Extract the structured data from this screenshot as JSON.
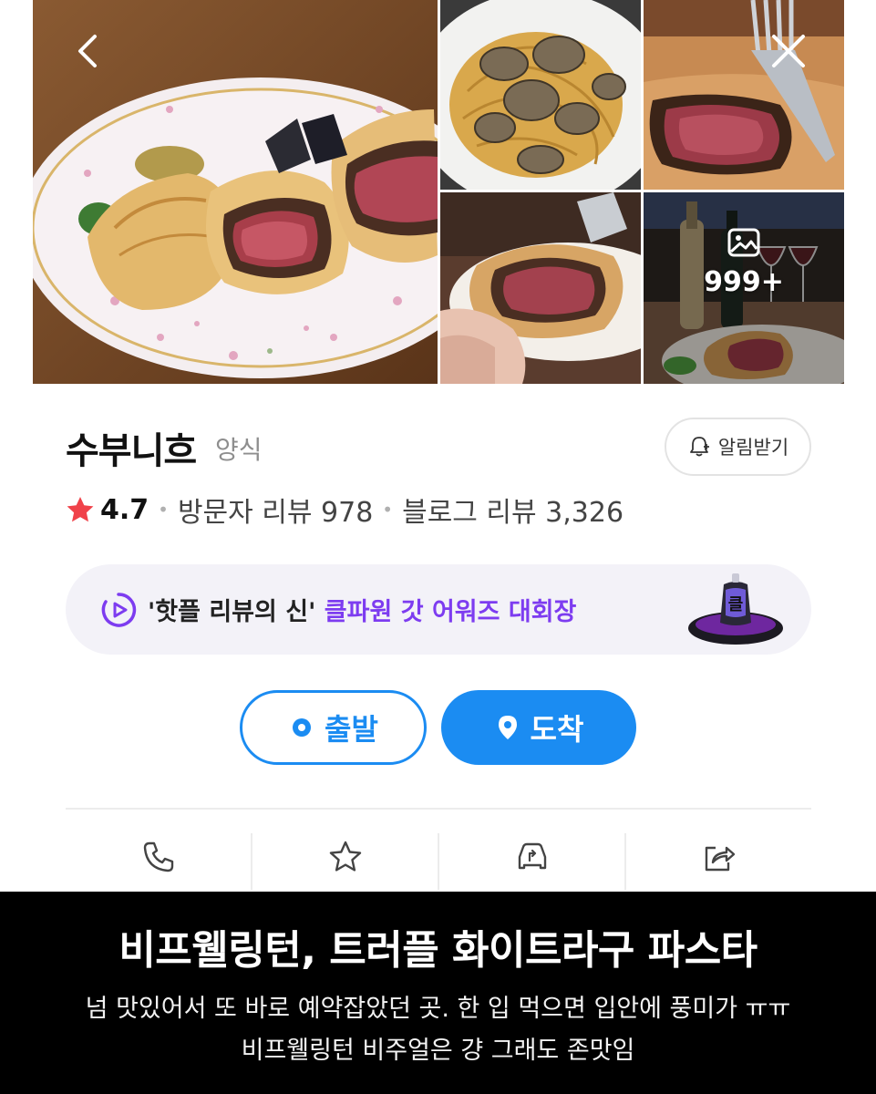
{
  "gallery": {
    "photos": [
      "beef-wellington-plate",
      "truffle-pasta",
      "wellington-cut-with-fork",
      "wellington-held-slice",
      "wine-and-wellington"
    ],
    "more_count": "999+"
  },
  "place": {
    "name": "수부니흐",
    "category": "양식",
    "alarm_label": "알림받기",
    "rating": "4.7",
    "visitor_reviews": "방문자 리뷰 978",
    "blog_reviews": "블로그 리뷰 3,326"
  },
  "promo": {
    "quote_text": "'핫플 리뷰의 신' ",
    "highlight_text": "클파원 갓 어워즈 대회장",
    "accent_color": "#7d3cf0"
  },
  "route": {
    "start_label": "출발",
    "end_label": "도착",
    "accent_color": "#1b8cf2"
  },
  "actions": [
    "phone-icon",
    "star-icon",
    "car-share-icon",
    "share-icon"
  ],
  "caption": {
    "title": "비프웰링턴, 트러플 화이트라구 파스타",
    "line1": "넘 맛있어서 또 바로 예약잡았던 곳. 한 입 먹으면 입안에 풍미가 ㅠㅠ",
    "line2": "비프웰링턴 비주얼은 걍 그래도 존맛임"
  }
}
